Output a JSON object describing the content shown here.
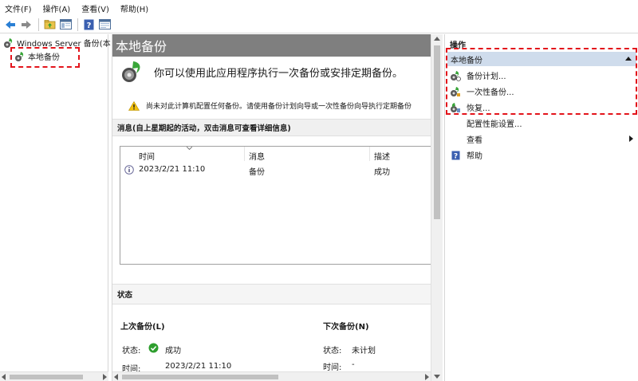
{
  "menubar": {
    "items": [
      "文件(F)",
      "操作(A)",
      "查看(V)",
      "帮助(H)"
    ]
  },
  "toolbar": {
    "buttons": [
      "back-arrow-icon",
      "forward-arrow-icon",
      "up-folder-icon",
      "show-hide-tree-icon",
      "help-icon",
      "properties-icon"
    ]
  },
  "tree": {
    "root_label": "Windows Server 备份(本",
    "child_label": "本地备份"
  },
  "center": {
    "title": "本地备份",
    "header_text": "你可以使用此应用程序执行一次备份或安排定期备份。",
    "warning_text": "尚未对此计算机配置任何备份。请使用备份计划向导或一次性备份向导执行定期备份",
    "messages_section": "消息(自上星期起的活动，双击消息可查看详细信息)",
    "messages_table": {
      "columns": [
        "时间",
        "消息",
        "描述"
      ],
      "rows": [
        {
          "time": "2023/2/21 11:10",
          "message": "备份",
          "description": "成功"
        }
      ]
    },
    "status_section": "状态",
    "last_backup": {
      "heading": "上次备份(L)",
      "status_label": "状态:",
      "status_value": "成功",
      "time_label": "时间:",
      "time_value": "2023/2/21 11:10"
    },
    "next_backup": {
      "heading": "下次备份(N)",
      "status_label": "状态:",
      "status_value": "未计划",
      "time_label": "时间:",
      "time_value": "-"
    }
  },
  "actions": {
    "title": "操作",
    "group_label": "本地备份",
    "items": [
      {
        "label": "备份计划...",
        "icon": "backup-schedule-icon"
      },
      {
        "label": "一次性备份...",
        "icon": "backup-once-icon"
      },
      {
        "label": "恢复...",
        "icon": "recover-icon"
      },
      {
        "label": "配置性能设置...",
        "icon": ""
      },
      {
        "label": "查看",
        "icon": ""
      },
      {
        "label": "帮助",
        "icon": "help-icon"
      }
    ]
  },
  "colors": {
    "highlight_dash": "#e3141b",
    "title_bar": "#7f7f7f",
    "actions_group_bg": "#cfdcec",
    "success_green": "#2e9e2e"
  }
}
